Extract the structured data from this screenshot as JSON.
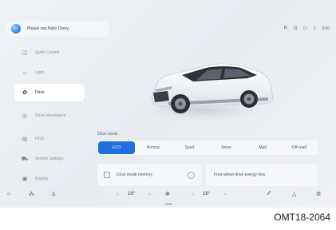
{
  "voice": {
    "prompt": "Please say Hello Chery"
  },
  "status": {
    "a": "R",
    "b": "G",
    "c": "▷",
    "d": "(",
    "time": "9:00"
  },
  "sidebar": {
    "items": [
      {
        "label": "Quick Control",
        "icon": "steering-icon"
      },
      {
        "label": "Light",
        "icon": "light-icon"
      },
      {
        "label": "Drive",
        "icon": "drive-icon"
      },
      {
        "label": "Driver Assistance",
        "icon": "assist-icon"
      },
      {
        "label": "HOD",
        "icon": "hod-icon"
      },
      {
        "label": "Vehicle Settings",
        "icon": "car-icon"
      },
      {
        "label": "Display",
        "icon": "display-icon"
      }
    ],
    "active_index": 2
  },
  "drive": {
    "title": "Drive mode",
    "modes": [
      "ECO",
      "Normal",
      "Sport",
      "Snow",
      "Mud",
      "Off-road"
    ],
    "selected": "ECO",
    "memory_label": "Drive mode memory",
    "energy_flow_label": "Four-wheel drive energy flow"
  },
  "dock": {
    "left_temp": "16°",
    "right_temp": "16°",
    "left_arrow": "<",
    "right_arrow": ">"
  },
  "caption": "OMT18-2064"
}
